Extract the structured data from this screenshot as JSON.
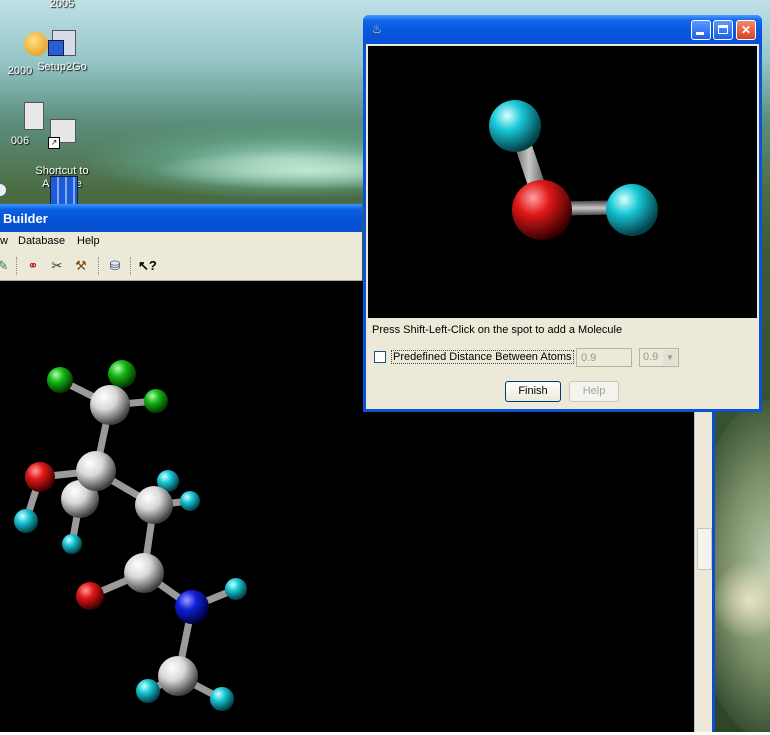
{
  "desktop": {
    "icons": [
      {
        "label": "2005"
      },
      {
        "label": "2000"
      },
      {
        "label": "Setup2Go"
      },
      {
        "label": "006"
      },
      {
        "label": "Shortcut to\nAdc.exe"
      }
    ]
  },
  "builder": {
    "title": "Builder",
    "menu": [
      "w",
      "Database",
      "Help"
    ],
    "toolbar_icons": [
      "edit-icon",
      "add-atom-icon",
      "cut-icon",
      "hammer-icon",
      "database-icon",
      "help-pointer-icon"
    ]
  },
  "dialog": {
    "title": "",
    "hint": "Press Shift-Left-Click on the spot to add a Molecule",
    "predefined_label": "Predefined Distance Between Atoms",
    "predefined_checked": false,
    "distance_value": "0.9",
    "distance_select_value": "0.9",
    "finish_label": "Finish",
    "help_label": "Help"
  },
  "colors": {
    "title_blue": "#0a52d6",
    "window_bg": "#ece9d8",
    "oxygen": "#e01818",
    "hydrogen": "#19c8d6",
    "carbon": "#e8e8e8",
    "nitrogen": "#1020d8",
    "fluorine": "#18b818"
  }
}
